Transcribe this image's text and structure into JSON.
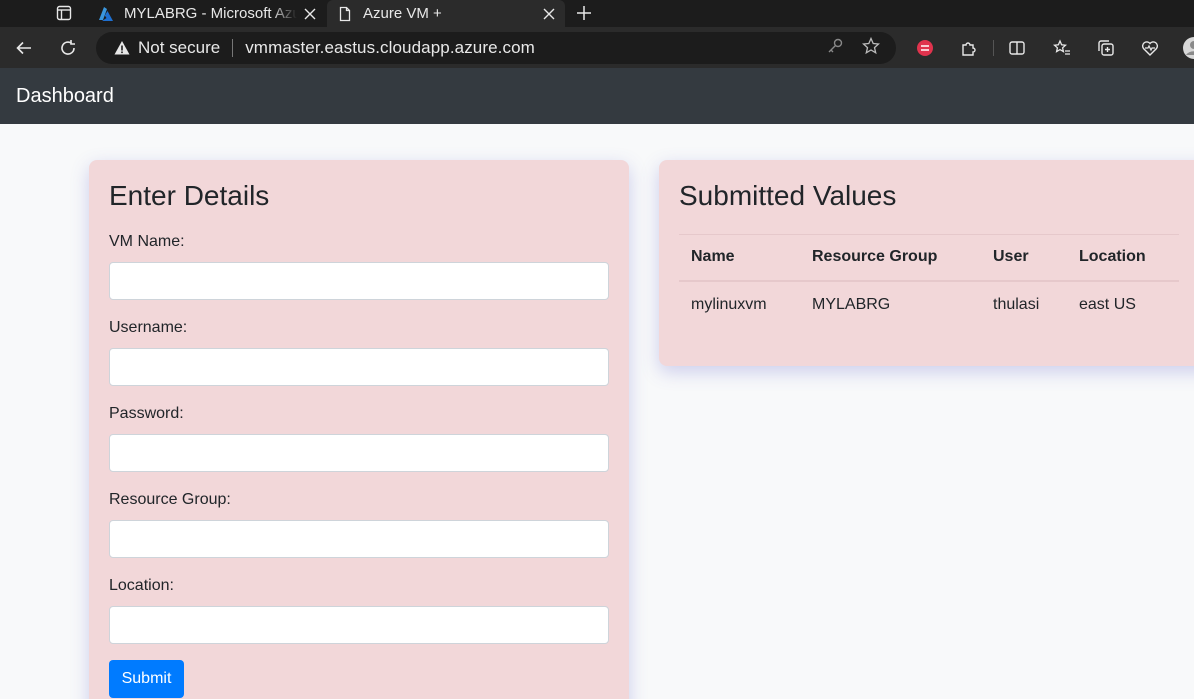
{
  "browser": {
    "tabs": [
      {
        "title": "MYLABRG - Microsoft Azure",
        "active": false,
        "icon": "azure-logo-icon"
      },
      {
        "title": "Azure VM +",
        "active": true,
        "icon": "document-icon"
      }
    ],
    "address_bar": {
      "security_label": "Not secure",
      "url": "vmmaster.eastus.cloudapp.azure.com"
    }
  },
  "navbar": {
    "brand": "Dashboard"
  },
  "form": {
    "title": "Enter Details",
    "fields": [
      {
        "label": "VM Name:",
        "value": ""
      },
      {
        "label": "Username:",
        "value": ""
      },
      {
        "label": "Password:",
        "value": ""
      },
      {
        "label": "Resource Group:",
        "value": ""
      },
      {
        "label": "Location:",
        "value": ""
      }
    ],
    "submit_label": "Submit"
  },
  "submitted": {
    "title": "Submitted Values",
    "headers": [
      "Name",
      "Resource Group",
      "User",
      "Location"
    ],
    "rows": [
      [
        "mylinuxvm",
        "MYLABRG",
        "thulasi",
        "east US"
      ]
    ]
  },
  "colors": {
    "navbar_bg": "#343a40",
    "card_bg": "#f2d7d9",
    "primary": "#007bff"
  }
}
